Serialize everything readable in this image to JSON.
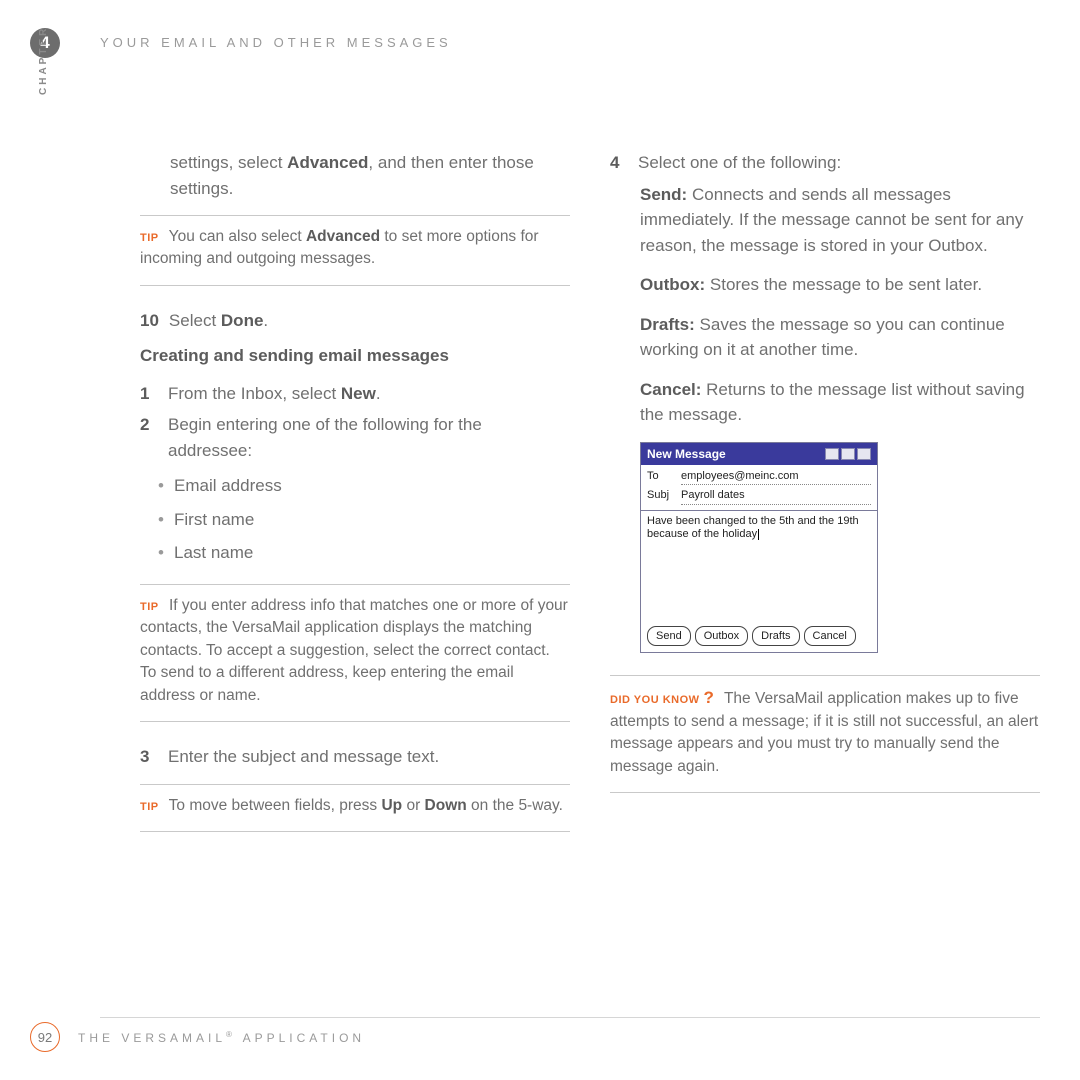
{
  "chapter_number": "4",
  "header_title": "YOUR EMAIL AND OTHER MESSAGES",
  "vertical_label": "CHAPTER",
  "left": {
    "intro_part1": "settings, select ",
    "intro_bold": "Advanced",
    "intro_part2": ", and then enter those settings.",
    "tip1_a": "You can also select ",
    "tip1_bold": "Advanced",
    "tip1_b": " to set more options for incoming and outgoing messages.",
    "step10_num": "10",
    "step10_a": "Select ",
    "step10_bold": "Done",
    "step10_b": ".",
    "subhead": "Creating and sending email messages",
    "s1_num": "1",
    "s1_a": "From the Inbox, select ",
    "s1_bold": "New",
    "s1_b": ".",
    "s2_num": "2",
    "s2_text": "Begin entering one of the following for the addressee:",
    "b1": "Email address",
    "b2": "First name",
    "b3": "Last name",
    "tip2": "If you enter address info that matches one or more of your contacts, the VersaMail application displays the matching contacts. To accept a suggestion, select the correct contact. To send to a different address, keep entering the email address or name.",
    "s3_num": "3",
    "s3_text": "Enter the subject and message text.",
    "tip3_a": "To move between fields, press ",
    "tip3_bold1": "Up",
    "tip3_mid": " or ",
    "tip3_bold2": "Down",
    "tip3_b": " on the 5-way."
  },
  "right": {
    "s4_num": "4",
    "s4_text": "Select one of the following:",
    "send_label": "Send:",
    "send_text": " Connects and sends all messages immediately. If the message cannot be sent for any reason, the message is stored in your Outbox.",
    "outbox_label": "Outbox:",
    "outbox_text": " Stores the message to be sent later.",
    "drafts_label": "Drafts:",
    "drafts_text": " Saves the message so you can continue working on it at another time.",
    "cancel_label": "Cancel:",
    "cancel_text": " Returns to the message list without saving the message.",
    "dyk_text": "The VersaMail application makes up to five attempts to send a message; if it is still not successful, an alert message appears and you must try to manually send the message again."
  },
  "screenshot": {
    "title": "New Message",
    "to_label": "To",
    "to_value": "employees@meinc.com",
    "subj_label": "Subj",
    "subj_value": "Payroll dates",
    "body": "Have been changed to the 5th and the 19th because of the holiday",
    "btn_send": "Send",
    "btn_outbox": "Outbox",
    "btn_drafts": "Drafts",
    "btn_cancel": "Cancel"
  },
  "labels": {
    "tip": "TIP",
    "did_you_know": "DID YOU KNOW"
  },
  "footer": {
    "page": "92",
    "text_a": "THE VERSAMAIL",
    "text_b": " APPLICATION"
  }
}
